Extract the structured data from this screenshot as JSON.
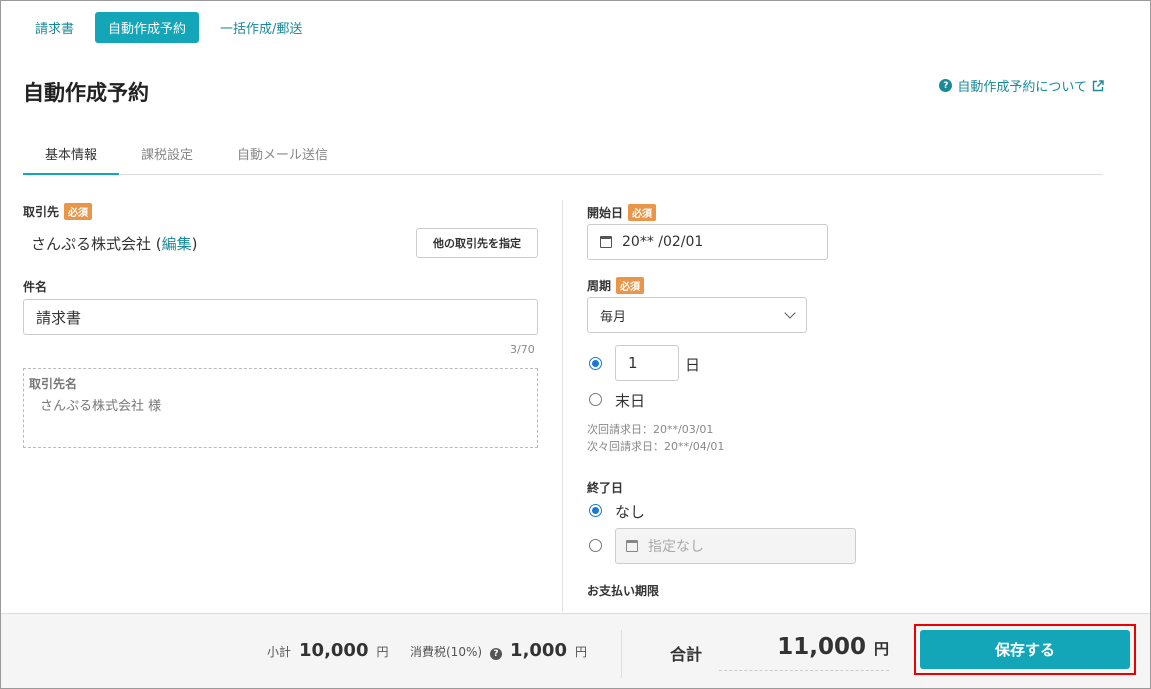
{
  "nav": {
    "items": [
      {
        "label": "請求書",
        "active": false
      },
      {
        "label": "自動作成予約",
        "active": true
      },
      {
        "label": "一括作成/郵送",
        "active": false
      }
    ]
  },
  "page": {
    "title": "自動作成予約",
    "help_link": "自動作成予約について"
  },
  "tabs": [
    {
      "label": "基本情報",
      "active": true
    },
    {
      "label": "課税設定",
      "active": false
    },
    {
      "label": "自動メール送信",
      "active": false
    }
  ],
  "required_badge": "必須",
  "left": {
    "client_label": "取引先",
    "client_name": "さんぷる株式会社 (",
    "client_edit": "編集",
    "client_close": ")",
    "other_client_button": "他の取引先を指定",
    "subject_label": "件名",
    "subject_value": "請求書",
    "subject_counter": "3/70",
    "client_display_label": "取引先名",
    "client_display_value": "さんぷる株式会社 様"
  },
  "right": {
    "start_label": "開始日",
    "start_value": "20** /02/01",
    "cycle_label": "周期",
    "cycle_value": "毎月",
    "day_value": "1",
    "day_unit": "日",
    "end_of_month_label": "末日",
    "next_date": "次回請求日：20**/03/01",
    "next_next_date": "次々回請求日：20**/04/01",
    "end_label": "終了日",
    "end_none_label": "なし",
    "end_date_placeholder": "指定なし",
    "due_label": "お支払い期限"
  },
  "footer": {
    "subtotal_label": "小計",
    "subtotal_value": "10,000",
    "tax_label": "消費税(10%)",
    "tax_value": "1,000",
    "unit": "円",
    "total_label": "合計",
    "total_value": "11,000",
    "save_label": "保存する"
  },
  "colors": {
    "accent": "#12a6b8",
    "link": "#1a8a99",
    "required": "#e9954a",
    "radio": "#1978d4"
  }
}
